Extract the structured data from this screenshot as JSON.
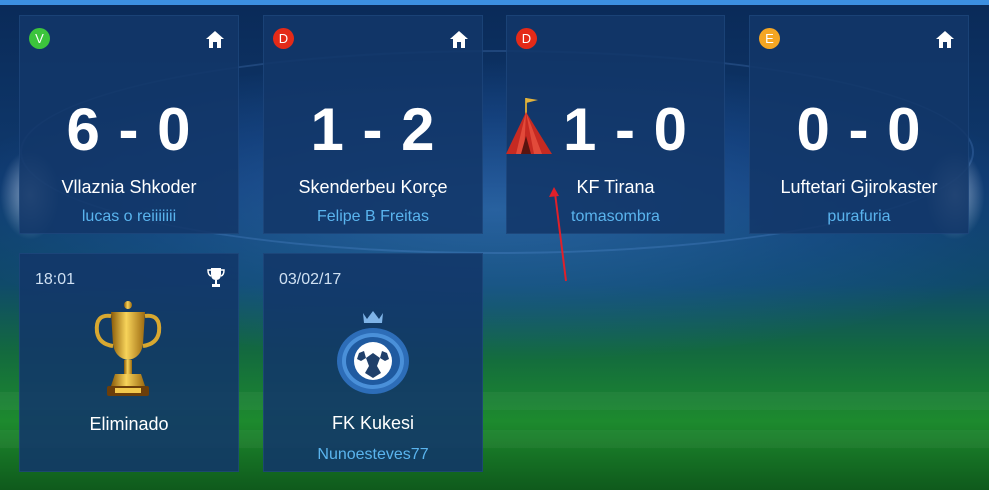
{
  "matches": [
    {
      "result_badge": "V",
      "score": "6 - 0",
      "team": "Vllaznia Shkoder",
      "user": "lucas o reiiiiiii",
      "home_icon": "home-icon"
    },
    {
      "result_badge": "D",
      "score": "1 - 2",
      "team": "Skenderbeu Korçe",
      "user": "Felipe B Freitas",
      "home_icon": "home-icon"
    },
    {
      "result_badge": "D",
      "score": "1 - 0",
      "team": "KF Tirana",
      "user": "tomasombra",
      "opponent_icon": "tent-icon"
    },
    {
      "result_badge": "E",
      "score": "0 - 0",
      "team": "Luftetari Gjirokaster",
      "user": "purafuria",
      "home_icon": "home-icon"
    }
  ],
  "cup": {
    "time": "18:01",
    "status": "Eliminado",
    "icon": "trophy-icon"
  },
  "next_match": {
    "date": "03/02/17",
    "team": "FK Kukesi",
    "user": "Nunoesteves77",
    "icon": "crest-icon"
  },
  "colors": {
    "win": "#3cc43c",
    "loss": "#e42a18",
    "draw": "#f5a623",
    "link": "#5ab4ee",
    "annotation": "#e0202a"
  }
}
